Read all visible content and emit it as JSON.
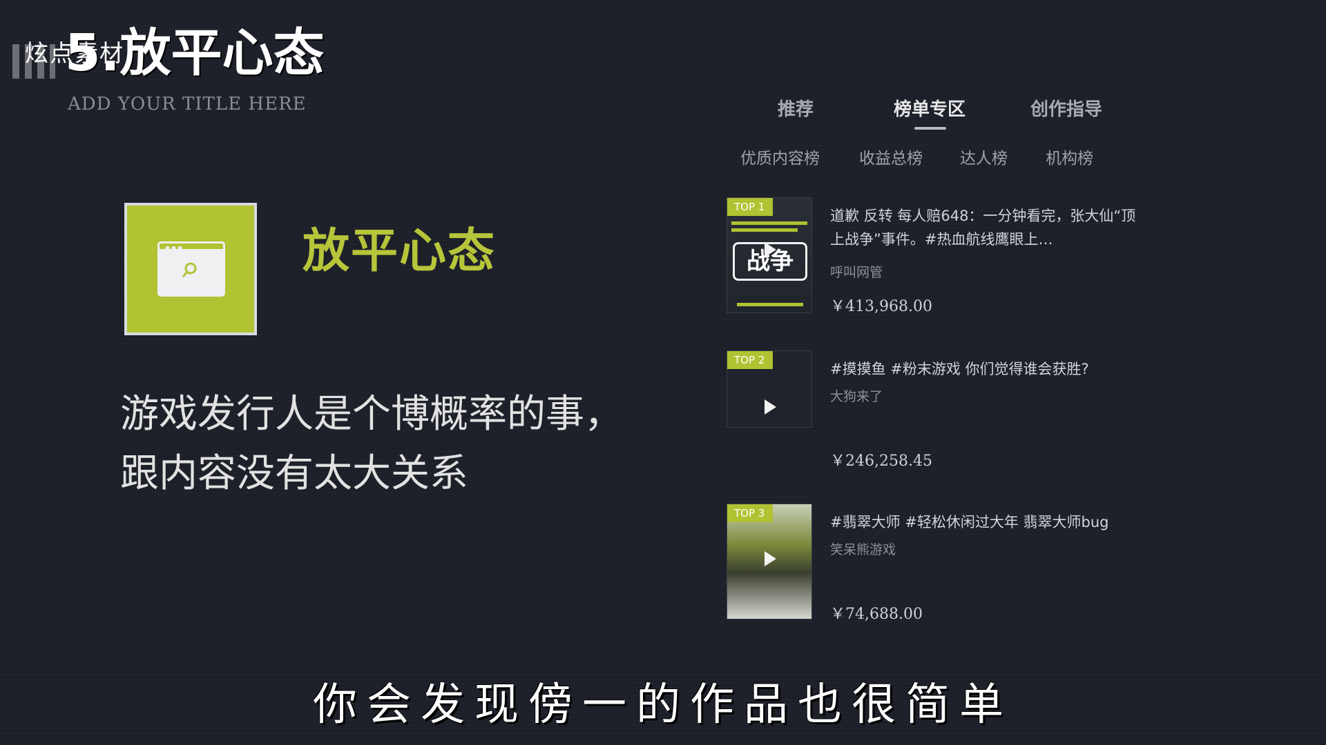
{
  "watermark": "炫点素材",
  "slide": {
    "section_title": "5.放平心态",
    "subtitle": "ADD YOUR TITLE HERE",
    "heading": "放平心态",
    "body_lines": [
      "游戏发行人是个博概率的事，",
      "跟内容没有太大关系"
    ]
  },
  "panel": {
    "tabs": [
      {
        "label": "推荐"
      },
      {
        "label": "榜单专区"
      },
      {
        "label": "创作指导"
      }
    ],
    "subtabs": [
      {
        "label": "优质内容榜"
      },
      {
        "label": "收益总榜"
      },
      {
        "label": "达人榜"
      },
      {
        "label": "机构榜"
      }
    ],
    "items": [
      {
        "badge": "TOP 1",
        "thumb_text": "战争",
        "title": "道歉 反转 每人赔648：一分钟看完，张大仙“顶上战争”事件。#热血航线鹰眼上…",
        "author": "呼叫网管",
        "amount": "￥413,968.00"
      },
      {
        "badge": "TOP 2",
        "title": "#摸摸鱼 #粉末游戏 你们觉得谁会获胜?",
        "author": "大狗来了",
        "amount": "￥246,258.45"
      },
      {
        "badge": "TOP 3",
        "title": "#翡翠大师 #轻松休闲过大年 翡翠大师bug",
        "author": "笑呆熊游戏",
        "amount": "￥74,688.00"
      }
    ]
  },
  "caption": "你会发现傍一的作品也很简单",
  "colors": {
    "background": "#1d2029",
    "accent_green": "#b1c232",
    "heading_green": "#b6c53a"
  }
}
